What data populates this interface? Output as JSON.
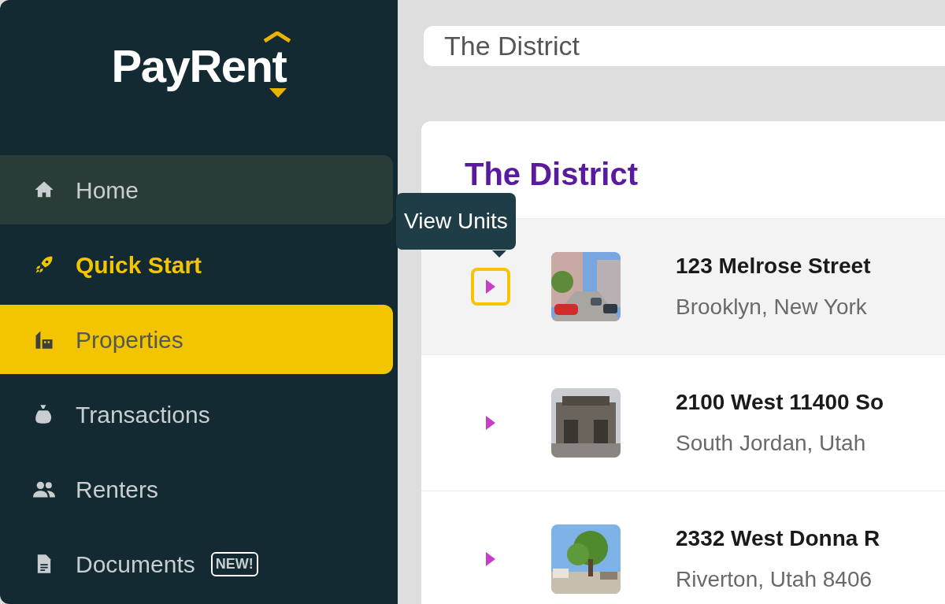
{
  "logo": {
    "text": "PayRent"
  },
  "nav": [
    {
      "label": "Home",
      "selected": false,
      "hovered": true,
      "accent": false
    },
    {
      "label": "Quick Start",
      "selected": false,
      "hovered": false,
      "accent": true
    },
    {
      "label": "Properties",
      "selected": true,
      "hovered": false,
      "accent": false
    },
    {
      "label": "Transactions",
      "selected": false,
      "hovered": false,
      "accent": false
    },
    {
      "label": "Renters",
      "selected": false,
      "hovered": false,
      "accent": false
    },
    {
      "label": "Documents",
      "selected": false,
      "hovered": false,
      "accent": false,
      "badge": "NEW!"
    }
  ],
  "search": {
    "value": "The District"
  },
  "group": {
    "title": "The District",
    "tooltip": "View Units",
    "properties": [
      {
        "title": "123 Melrose Street",
        "subtitle": "Brooklyn, New York",
        "hovered": true,
        "focused": true
      },
      {
        "title": "2100 West 11400 So",
        "subtitle": "South Jordan, Utah",
        "hovered": false,
        "focused": false
      },
      {
        "title": "2332 West Donna R",
        "subtitle": "Riverton, Utah 8406",
        "hovered": false,
        "focused": false
      }
    ]
  }
}
